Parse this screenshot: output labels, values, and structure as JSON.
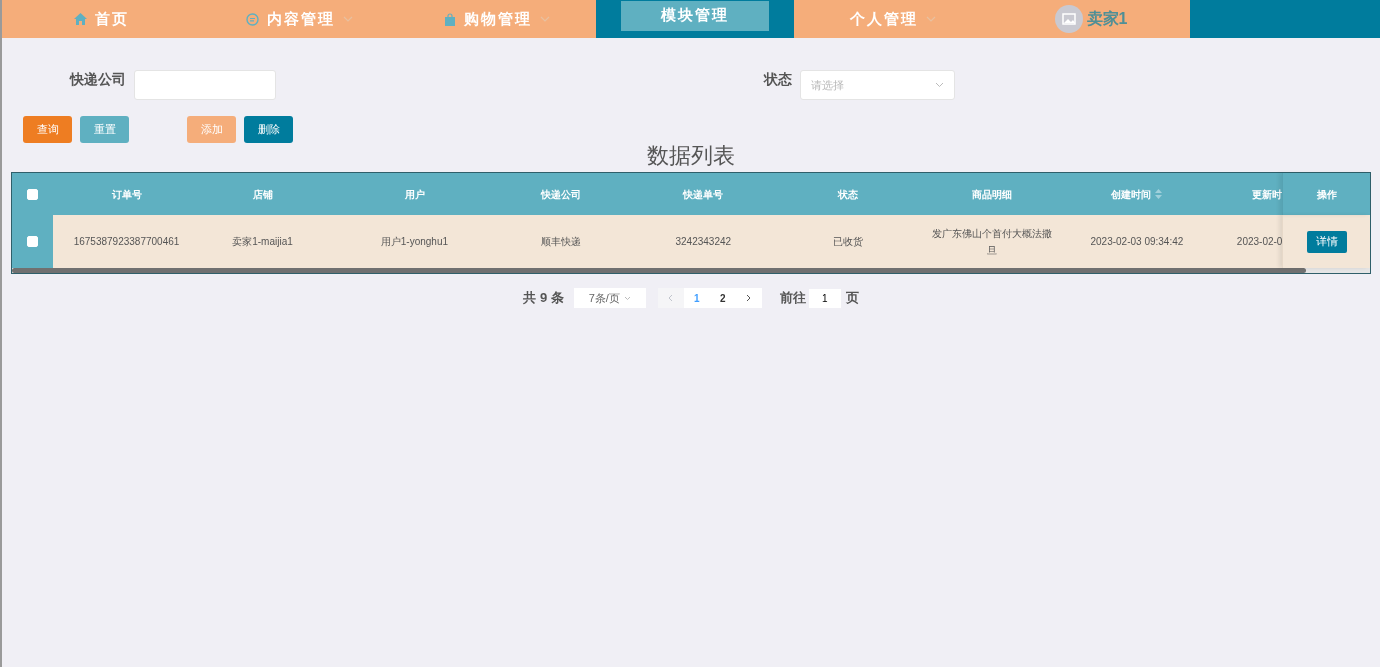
{
  "nav": [
    {
      "label": "首页",
      "kind": "home",
      "dropdown": false,
      "selected": false
    },
    {
      "label": "内容管理",
      "kind": "chat",
      "dropdown": true,
      "selected": false
    },
    {
      "label": "购物管理",
      "kind": "bag",
      "dropdown": true,
      "selected": false
    },
    {
      "label": "模块管理",
      "kind": "plain",
      "dropdown": false,
      "selected": true
    },
    {
      "label": "个人管理",
      "kind": "plain",
      "dropdown": true,
      "selected": false
    }
  ],
  "user": {
    "name": "卖家1"
  },
  "filters": [
    {
      "kind": "text",
      "label": "快递公司"
    },
    {
      "kind": "select",
      "label": "状态",
      "placeholder": "请选择"
    }
  ],
  "buttons": [
    {
      "label": "查询",
      "kind": "primary"
    },
    {
      "label": "重置",
      "kind": "secondary"
    },
    {
      "label": "添加",
      "kind": "add"
    },
    {
      "label": "删除",
      "kind": "danger"
    }
  ],
  "table": {
    "title": "数据列表",
    "select_all_checked": false,
    "columns": [
      {
        "label": "订单号",
        "sortable": false
      },
      {
        "label": "店铺",
        "sortable": false
      },
      {
        "label": "用户",
        "sortable": false
      },
      {
        "label": "快递公司",
        "sortable": false
      },
      {
        "label": "快递单号",
        "sortable": false
      },
      {
        "label": "状态",
        "sortable": false
      },
      {
        "label": "商品明细",
        "sortable": false
      },
      {
        "label": "创建时间",
        "sortable": true
      },
      {
        "label": "更新时",
        "sortable": false
      }
    ],
    "action_column": "操作",
    "rows": [
      {
        "checked": false,
        "cells": [
          "1675387923387700461",
          "卖家1-maijia1",
          "用户1-yonghu1",
          "顺丰快递",
          "3242343242",
          "已收货",
          "发广东佛山个首付大概法撒旦",
          "2023-02-03 09:34:42",
          "2023-02-0"
        ],
        "action": "详情"
      }
    ]
  },
  "pagination": {
    "total": "共 9 条",
    "page_size": "7条/页",
    "pages": [
      {
        "label": "1",
        "selected": true
      },
      {
        "label": "2",
        "selected": false
      }
    ],
    "goto_label": "前往",
    "goto_value": "1",
    "page_suffix": "页"
  }
}
